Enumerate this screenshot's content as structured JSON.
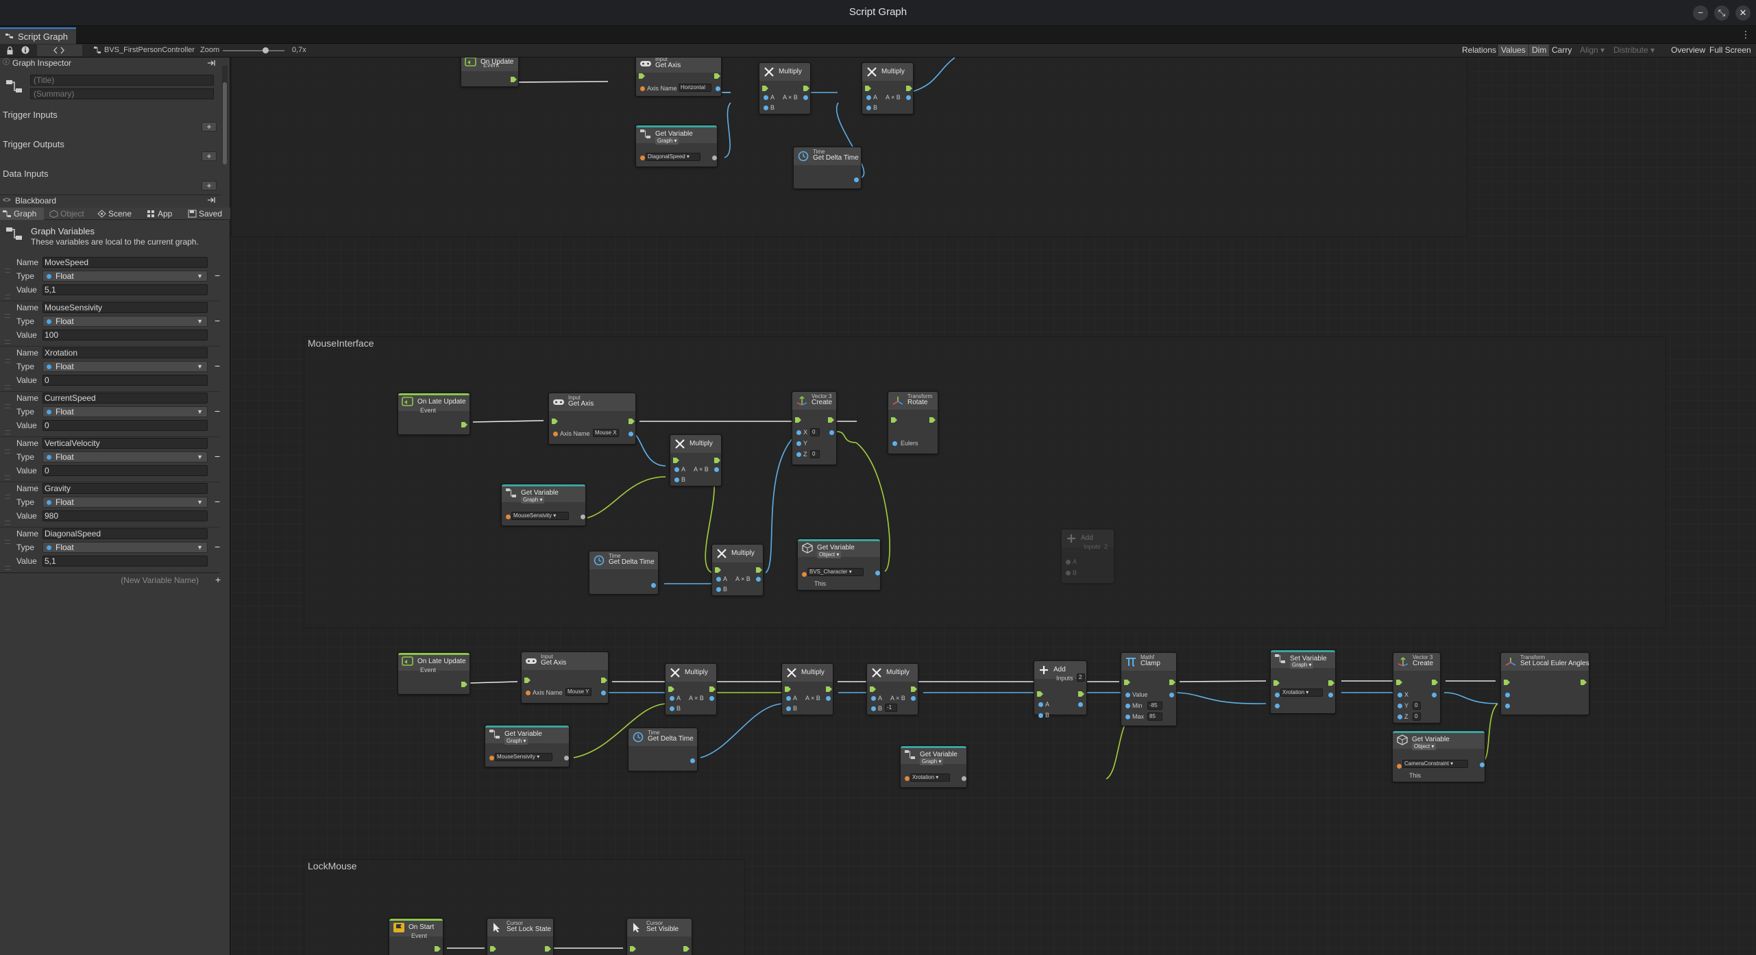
{
  "window": {
    "title": "Script Graph",
    "minimize_glyph": "−",
    "restore_glyph": "⤡",
    "close_glyph": "✕"
  },
  "tab": {
    "label": "Script Graph",
    "menu_glyph": "⋮"
  },
  "toolbar": {
    "asset_name": "BVS_FirstPersonController",
    "zoom_label": "Zoom",
    "zoom_value": "0,7x",
    "buttons": {
      "relations": "Relations",
      "values": "Values",
      "dim": "Dim",
      "carry": "Carry",
      "align": "Align ▾",
      "distribute": "Distribute ▾",
      "overview": "Overview",
      "full_screen": "Full Screen"
    }
  },
  "inspector": {
    "header": "Graph Inspector",
    "title_placeholder": "(Title)",
    "summary_placeholder": "(Summary)",
    "trigger_inputs": "Trigger Inputs",
    "trigger_outputs": "Trigger Outputs",
    "data_inputs": "Data Inputs",
    "plus": "+"
  },
  "blackboard": {
    "header": "Blackboard",
    "tabs": [
      "Graph",
      "Object",
      "Scene",
      "App",
      "Saved"
    ],
    "section_title": "Graph Variables",
    "section_desc": "These variables are local to the current graph.",
    "labels": {
      "name": "Name",
      "type": "Type",
      "value": "Value"
    },
    "variables": [
      {
        "name": "MoveSpeed",
        "type": "Float",
        "value": "5,1"
      },
      {
        "name": "MouseSensivity",
        "type": "Float",
        "value": "100"
      },
      {
        "name": "Xrotation",
        "type": "Float",
        "value": "0"
      },
      {
        "name": "CurrentSpeed",
        "type": "Float",
        "value": "0"
      },
      {
        "name": "VerticalVelocity",
        "type": "Float",
        "value": "0"
      },
      {
        "name": "Gravity",
        "type": "Float",
        "value": "980"
      },
      {
        "name": "DiagonalSpeed",
        "type": "Float",
        "value": "5,1"
      }
    ],
    "new_variable_placeholder": "(New Variable Name)",
    "minus": "−",
    "plus": "+"
  },
  "graph": {
    "groups": {
      "mouse": "MouseInterface",
      "lock": "LockMouse"
    },
    "top": {
      "on_update": {
        "sub": "",
        "title": "On Update",
        "sub2": "Event"
      },
      "get_axis": {
        "sub": "Input",
        "title": "Get Axis",
        "axis_label": "Axis Name",
        "axis_value": "Horizontal"
      },
      "multiply1": {
        "title": "Multiply",
        "a": "A",
        "b": "B",
        "out": "A × B"
      },
      "multiply2": {
        "title": "Multiply",
        "a": "A",
        "b": "B",
        "out": "A × B"
      },
      "get_var": {
        "title": "Get Variable",
        "scope": "Graph ▾",
        "var": "DiagonalSpeed ▾"
      },
      "delta": {
        "sub": "Time",
        "title": "Get Delta Time"
      }
    },
    "mouse1": {
      "on_late": {
        "title": "On Late Update",
        "sub": "Event"
      },
      "get_axis": {
        "sub": "Input",
        "title": "Get Axis",
        "axis_label": "Axis Name",
        "axis_value": "Mouse X"
      },
      "vector3": {
        "sub": "Vector 3",
        "title": "Create",
        "x": "X",
        "y": "Y",
        "z": "Z",
        "x_val": "0",
        "z_val": "0"
      },
      "rotate": {
        "sub": "Transform",
        "title": "Rotate",
        "eulers": "Eulers"
      },
      "multiply1": {
        "title": "Multiply",
        "a": "A",
        "b": "B",
        "out": "A × B"
      },
      "multiply2": {
        "title": "Multiply",
        "a": "A",
        "b": "B",
        "out": "A × B"
      },
      "get_var": {
        "title": "Get Variable",
        "scope": "Graph ▾",
        "var": "MouseSensivity ▾"
      },
      "delta": {
        "sub": "Time",
        "title": "Get Delta Time"
      },
      "get_obj": {
        "title": "Get Variable",
        "scope": "Object ▾",
        "var": "BVS_Character ▾",
        "this": "This"
      },
      "add_ghost": {
        "title": "Add",
        "sub": "Inputs",
        "count": "2",
        "a": "A",
        "b": "B"
      }
    },
    "mouse2": {
      "on_late": {
        "title": "On Late Update",
        "sub": "Event"
      },
      "get_axis": {
        "sub": "Input",
        "title": "Get Axis",
        "axis_label": "Axis Name",
        "axis_value": "Mouse Y"
      },
      "multiply1": {
        "title": "Multiply",
        "a": "A",
        "b": "B",
        "out": "A × B"
      },
      "multiply2": {
        "title": "Multiply",
        "a": "A",
        "b": "B",
        "out": "A × B"
      },
      "multiply3": {
        "title": "Multiply",
        "a": "A",
        "b": "B",
        "b_val": "-1",
        "out": "A × B"
      },
      "add": {
        "title": "Add",
        "sub": "Inputs",
        "count": "2",
        "a": "A",
        "b": "B"
      },
      "clamp": {
        "sub": "Mathf",
        "title": "Clamp",
        "value": "Value",
        "min": "Min",
        "max": "Max",
        "min_val": "-85",
        "max_val": "85"
      },
      "set_var": {
        "title": "Set Variable",
        "scope": "Graph ▾",
        "var": "Xrotation ▾"
      },
      "vector3": {
        "sub": "Vector 3",
        "title": "Create",
        "x": "X",
        "y": "Y",
        "z": "Z",
        "y_val": "0",
        "z_val": "0"
      },
      "set_euler": {
        "sub": "Transform",
        "title": "Set Local Euler Angles"
      },
      "get_var": {
        "title": "Get Variable",
        "scope": "Graph ▾",
        "var": "MouseSensivity ▾"
      },
      "delta": {
        "sub": "Time",
        "title": "Get Delta Time"
      },
      "get_xrot": {
        "title": "Get Variable",
        "scope": "Graph ▾",
        "var": "Xrotation ▾"
      },
      "get_cam": {
        "title": "Get Variable",
        "scope": "Object ▾",
        "var": "CameraConstraint ▾",
        "this": "This"
      }
    },
    "lock": {
      "on_start": {
        "title": "On Start",
        "sub": "Event"
      },
      "lock_state": {
        "sub": "Cursor",
        "title": "Set Lock State"
      },
      "visible": {
        "sub": "Cursor",
        "title": "Set Visible"
      }
    }
  },
  "colors": {
    "flow": "#9fd05b",
    "value": "#5fb0ea",
    "green_wire": "#a6cf3e",
    "accent": "#3a7bd5"
  }
}
